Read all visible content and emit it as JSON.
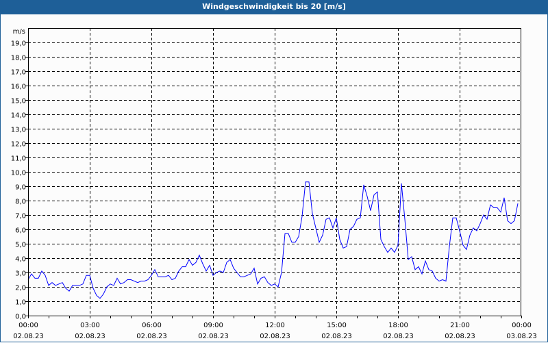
{
  "title": "Windgeschwindigkeit bis 20 [m/s]",
  "colors": {
    "titlebar": "#1e5f98",
    "line": "#0000ff",
    "grid": "#000000"
  },
  "chart_data": {
    "type": "line",
    "title": "Windgeschwindigkeit bis 20 [m/s]",
    "ylabel": "m/s",
    "xlabel": "",
    "ylim": [
      0,
      20
    ],
    "xlim_hours": [
      0,
      24
    ],
    "grid": true,
    "y_ticks": [
      "0,0",
      "1,0",
      "2,0",
      "3,0",
      "4,0",
      "5,0",
      "6,0",
      "7,0",
      "8,0",
      "9,0",
      "10,0",
      "11,0",
      "12,0",
      "13,0",
      "14,0",
      "15,0",
      "16,0",
      "17,0",
      "18,0",
      "19,0"
    ],
    "x_ticks": [
      {
        "time": "00:00",
        "date": "02.08.23"
      },
      {
        "time": "03:00",
        "date": "02.08.23"
      },
      {
        "time": "06:00",
        "date": "02.08.23"
      },
      {
        "time": "09:00",
        "date": "02.08.23"
      },
      {
        "time": "12:00",
        "date": "02.08.23"
      },
      {
        "time": "15:00",
        "date": "02.08.23"
      },
      {
        "time": "18:00",
        "date": "02.08.23"
      },
      {
        "time": "21:00",
        "date": "02.08.23"
      },
      {
        "time": "00:00",
        "date": "03.08.23"
      }
    ],
    "interval_minutes": 10,
    "series": [
      {
        "name": "Windgeschwindigkeit",
        "values": [
          2.5,
          2.9,
          2.6,
          2.6,
          3.1,
          2.8,
          2.1,
          2.3,
          2.1,
          2.2,
          2.3,
          1.9,
          1.7,
          2.1,
          2.1,
          2.1,
          2.2,
          2.8,
          2.8,
          1.9,
          1.4,
          1.2,
          1.5,
          2.0,
          2.2,
          2.1,
          2.6,
          2.2,
          2.3,
          2.5,
          2.5,
          2.4,
          2.3,
          2.4,
          2.4,
          2.5,
          2.8,
          3.2,
          2.7,
          2.7,
          2.7,
          2.8,
          2.5,
          2.6,
          3.1,
          3.4,
          3.4,
          3.9,
          3.5,
          3.7,
          4.2,
          3.6,
          3.1,
          3.5,
          2.8,
          3.0,
          3.1,
          3.0,
          3.7,
          3.9,
          3.3,
          3.0,
          2.7,
          2.7,
          2.8,
          2.9,
          3.3,
          2.2,
          2.6,
          2.7,
          2.3,
          2.1,
          2.2,
          2.0,
          3.0,
          5.7,
          5.7,
          5.1,
          5.1,
          5.5,
          6.9,
          9.3,
          9.3,
          7.1,
          6.1,
          5.1,
          5.6,
          6.7,
          6.8,
          6.1,
          6.8,
          5.3,
          4.7,
          4.8,
          6.0,
          6.2,
          6.7,
          6.8,
          9.1,
          8.3,
          7.3,
          8.4,
          8.6,
          5.3,
          4.8,
          4.4,
          4.7,
          4.4,
          4.9,
          9.2,
          6.7,
          3.9,
          4.1,
          3.2,
          3.4,
          2.9,
          3.8,
          3.2,
          3.1,
          2.6,
          2.4,
          2.5,
          2.4,
          4.8,
          6.8,
          6.8,
          5.9,
          4.9,
          4.6,
          5.6,
          6.1,
          5.9,
          6.4,
          7.0,
          6.7,
          7.7,
          7.5,
          7.5,
          7.2,
          8.2,
          6.6,
          6.4,
          6.6,
          7.8
        ]
      }
    ]
  }
}
